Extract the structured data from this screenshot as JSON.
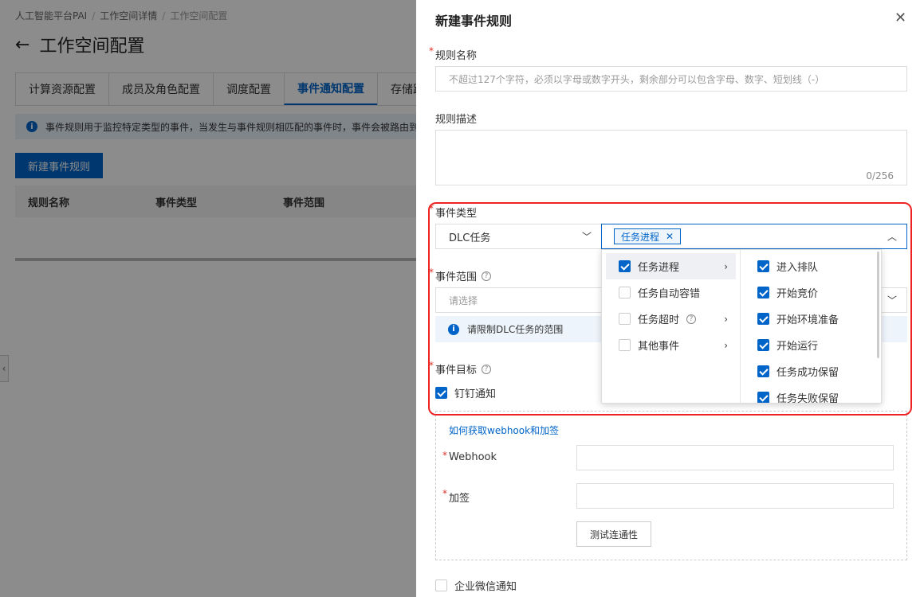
{
  "background": {
    "breadcrumb": [
      "人工智能平台PAI",
      "工作空间详情",
      "工作空间配置"
    ],
    "title": "工作空间配置",
    "tabs": [
      "计算资源配置",
      "成员及角色配置",
      "调度配置",
      "事件通知配置",
      "存储路"
    ],
    "info_text": "事件规则用于监控特定类型的事件，当发生与事件规则相匹配的事件时，事件会被路由到",
    "new_rule_button": "新建事件规则",
    "table_headers": [
      "规则名称",
      "事件类型",
      "事件范围"
    ]
  },
  "drawer": {
    "title": "新建事件规则",
    "rule_name": {
      "label": "规则名称",
      "placeholder": "不超过127个字符，必须以字母或数字开头，剩余部分可以包含字母、数字、短划线（-）"
    },
    "rule_desc": {
      "label": "规则描述",
      "counter": "0/256"
    },
    "event_type": {
      "label": "事件类型",
      "source_value": "DLC任务",
      "selected_tag": "任务进程"
    },
    "event_scope": {
      "label": "事件范围",
      "placeholder": "请选择",
      "note": "请限制DLC任务的范围"
    },
    "event_target": {
      "label": "事件目标",
      "dingtalk": "钉钉通知",
      "webhook_help_link": "如何获取webhook和加签",
      "webhook_label": "Webhook",
      "sign_label": "加签",
      "test_button": "测试连通性",
      "wecom": "企业微信通知"
    }
  },
  "cascader": {
    "level1": [
      {
        "label": "任务进程",
        "checked": true,
        "has_children": true,
        "active": true
      },
      {
        "label": "任务自动容错",
        "checked": false,
        "has_children": false,
        "help": false
      },
      {
        "label": "任务超时",
        "checked": false,
        "has_children": true,
        "help": true
      },
      {
        "label": "其他事件",
        "checked": false,
        "has_children": true,
        "help": false
      }
    ],
    "level2": [
      {
        "label": "进入排队",
        "checked": true
      },
      {
        "label": "开始竞价",
        "checked": true
      },
      {
        "label": "开始环境准备",
        "checked": true
      },
      {
        "label": "开始运行",
        "checked": true
      },
      {
        "label": "任务成功保留",
        "checked": true
      },
      {
        "label": "任务失败保留",
        "checked": true
      }
    ]
  },
  "colors": {
    "primary": "#0064c8",
    "required": "#d93026",
    "highlight": "#ee2222"
  }
}
